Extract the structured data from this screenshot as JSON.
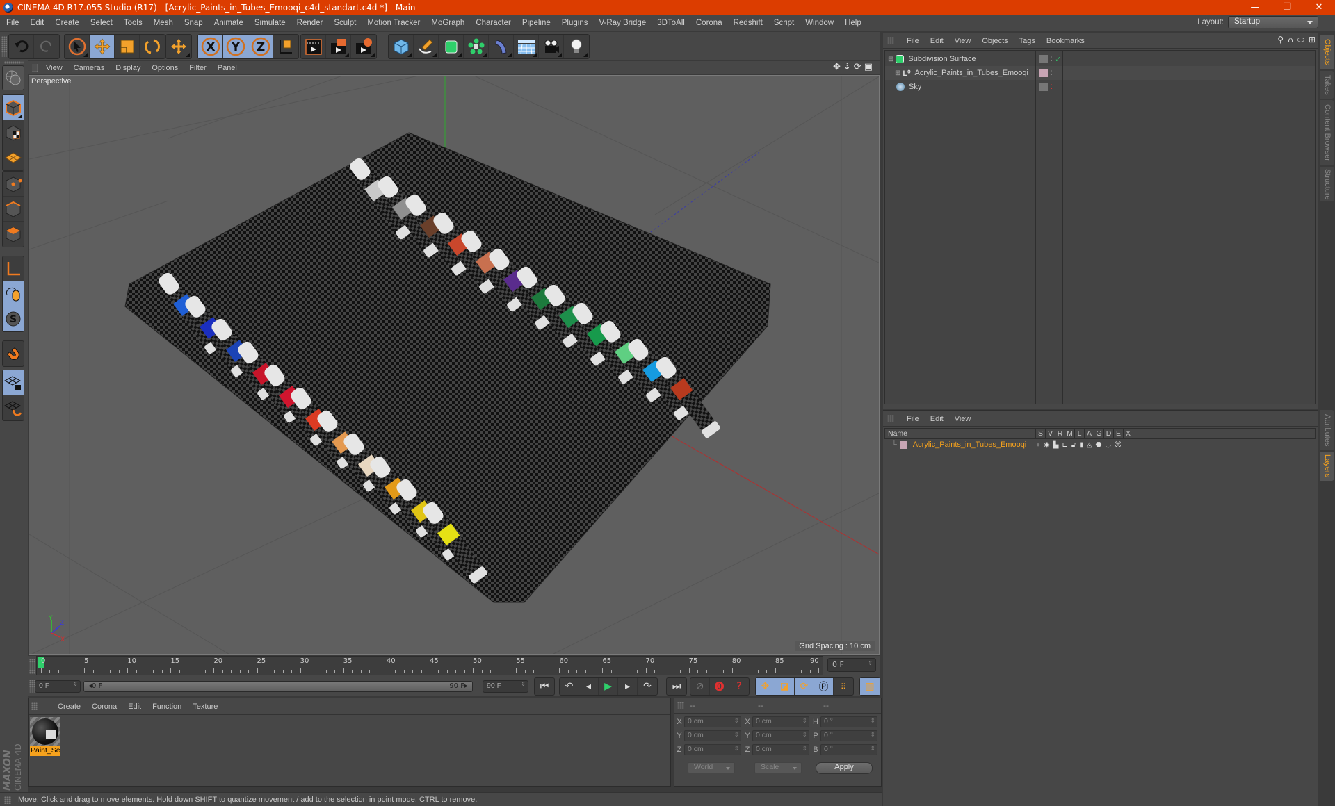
{
  "window": {
    "title": "CINEMA 4D R17.055 Studio (R17) - [Acrylic_Paints_in_Tubes_Emooqi_c4d_standart.c4d *] - Main",
    "controls": {
      "minimize": "—",
      "maximize": "❐",
      "close": "✕"
    }
  },
  "menubar": {
    "items": [
      "File",
      "Edit",
      "Create",
      "Select",
      "Tools",
      "Mesh",
      "Snap",
      "Animate",
      "Simulate",
      "Render",
      "Sculpt",
      "Motion Tracker",
      "MoGraph",
      "Character",
      "Pipeline",
      "Plugins",
      "V-Ray Bridge",
      "3DToAll",
      "Corona",
      "Redshift",
      "Script",
      "Window",
      "Help"
    ],
    "layout_label": "Layout:",
    "layout_value": "Startup"
  },
  "toolbar": {
    "groups": [
      [
        "undo-icon",
        "redo-icon"
      ],
      [
        "live-select-icon",
        "move-icon",
        "scale-icon",
        "rotate-icon"
      ],
      [
        "recent-tool-icon"
      ],
      [
        "x-axis-lock-icon",
        "y-axis-lock-icon",
        "z-axis-lock-icon",
        "world-coordinates-icon"
      ],
      [
        "render-view-icon",
        "render-picture-viewer-icon",
        "render-settings-icon"
      ],
      [
        "cube-icon",
        "pen-spline-icon",
        "subdivision-surface-icon",
        "cloner-icon",
        "deformer-bend-icon",
        "floor-grid-icon",
        "camera-icon",
        "light-icon"
      ]
    ],
    "active": [
      "move-icon",
      "x-axis-lock-icon",
      "y-axis-lock-icon",
      "z-axis-lock-icon"
    ]
  },
  "left_toolbar": {
    "items": [
      "make-editable-icon",
      "model-mode-icon",
      "texture-mode-icon",
      "workplane-mode-icon",
      "points-mode-icon",
      "edges-mode-icon",
      "polygons-mode-icon",
      "axis-mode-icon",
      "tweak-mode-icon",
      "solo-mode-icon",
      "snap-magnet-icon",
      "workplane-lock-icon",
      "workplane-align-icon"
    ]
  },
  "viewport": {
    "menu": [
      "View",
      "Cameras",
      "Display",
      "Options",
      "Filter",
      "Panel"
    ],
    "label": "Perspective",
    "grid_spacing": "Grid Spacing : 10 cm",
    "axis": {
      "x": "X",
      "y": "Y",
      "z": "Z"
    },
    "tube_colors": [
      "#1f5fd6",
      "#1b2fbf",
      "#1c44b5",
      "#c8152a",
      "#d0152e",
      "#db3b23",
      "#e49950",
      "#e8d7c0",
      "#e39a18",
      "#e1c515",
      "#e5e015",
      "#c9c9c9",
      "#8f8f8f",
      "#6a3f2a",
      "#c9472c",
      "#c8704f",
      "#5a2c8d",
      "#1d7a3d",
      "#1d8f4b",
      "#179a4c",
      "#5fcf82",
      "#169be0",
      "#b83a1e"
    ]
  },
  "timeline": {
    "ticks": [
      "0",
      "5",
      "10",
      "15",
      "20",
      "25",
      "30",
      "35",
      "40",
      "45",
      "50",
      "55",
      "60",
      "65",
      "70",
      "75",
      "80",
      "85",
      "90"
    ],
    "current_frame": "0 F",
    "start_field": "0 F",
    "range_start": "0 F",
    "range_end": "90 F",
    "end_field": "90 F",
    "playback": [
      "go-to-start-icon",
      "previous-key-icon",
      "step-back-icon",
      "play-icon",
      "step-forward-icon",
      "next-key-icon",
      "go-to-end-icon"
    ],
    "record": [
      "motion-record-icon",
      "autokey-icon",
      "keyframe-selection-icon"
    ],
    "key_tracks": [
      "key-position-icon",
      "key-scale-icon",
      "key-rotation-icon",
      "key-parameter-icon",
      "key-pla-icon"
    ],
    "timeline_button": "timeline-icon"
  },
  "materials": {
    "menu": [
      "Create",
      "Corona",
      "Edit",
      "Function",
      "Texture"
    ],
    "items": [
      {
        "name": "Paint_Se"
      }
    ]
  },
  "coordinates": {
    "headers": [
      "--",
      "--",
      "--"
    ],
    "rows": [
      {
        "l1": "X",
        "v1": "0 cm",
        "l2": "X",
        "v2": "0 cm",
        "l3": "H",
        "v3": "0 °"
      },
      {
        "l1": "Y",
        "v1": "0 cm",
        "l2": "Y",
        "v2": "0 cm",
        "l3": "P",
        "v3": "0 °"
      },
      {
        "l1": "Z",
        "v1": "0 cm",
        "l2": "Z",
        "v2": "0 cm",
        "l3": "B",
        "v3": "0 °"
      }
    ],
    "mode": "World",
    "transform": "Scale",
    "apply": "Apply"
  },
  "status": "Move: Click and drag to move elements. Hold down SHIFT to quantize movement / add to the selection in point mode, CTRL to remove.",
  "object_manager": {
    "menu": [
      "File",
      "Edit",
      "View",
      "Objects",
      "Tags",
      "Bookmarks"
    ],
    "objects": [
      {
        "name": "Subdivision Surface",
        "icon": "subdivision-surface-icon",
        "expanded": true,
        "checked": true
      },
      {
        "name": "Acrylic_Paints_in_Tubes_Emooqi",
        "icon": "null-object-icon",
        "expanded": false,
        "layer_color": "#c8a5b4"
      },
      {
        "name": "Sky",
        "icon": "sky-icon"
      }
    ]
  },
  "layer_manager": {
    "menu": [
      "File",
      "Edit",
      "View"
    ],
    "columns": [
      "Name",
      "S",
      "V",
      "R",
      "M",
      "L",
      "A",
      "G",
      "D",
      "E",
      "X"
    ],
    "layers": [
      {
        "name": "Acrylic_Paints_in_Tubes_Emooqi",
        "color": "#c8a5b4"
      }
    ]
  },
  "side_tabs": {
    "top": [
      "Objects",
      "Takes",
      "Content Browser",
      "Structure"
    ],
    "bottom": [
      "Attributes",
      "Layers"
    ]
  },
  "colors": {
    "accent": "#dc3d00",
    "highlight": "#f6a21d",
    "active_button": "#8ba7d3"
  }
}
